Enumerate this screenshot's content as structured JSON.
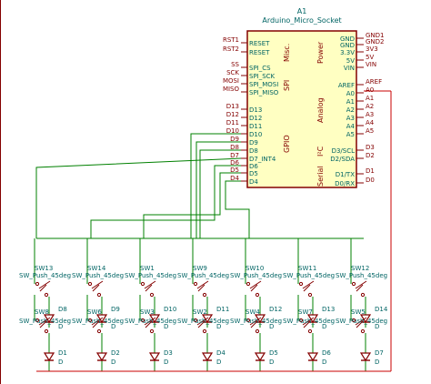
{
  "module": {
    "ref": "A1",
    "value": "Arduino_Micro_Socket",
    "sections": {
      "misc": "Misc.",
      "power": "Power",
      "spi": "SPI",
      "analog": "Analog",
      "i2c": "I²C",
      "serial": "Serial",
      "gpio": "GPIO"
    },
    "left_pins": [
      "RESET",
      "RESET",
      "SPI_CS",
      "SPI_SCK",
      "SPI_MOSI",
      "SPI_MISO",
      "D13",
      "D12",
      "D11",
      "D10",
      "D9",
      "D8",
      "D7_INT4",
      "D6",
      "D5",
      "D4"
    ],
    "right_pins": [
      "GND",
      "GND",
      "3.3V",
      "5V",
      "VIN",
      "AREF",
      "A0",
      "A1",
      "A2",
      "A3",
      "A4",
      "A5",
      "D3/SCL",
      "D2/SDA",
      "D1/TX",
      "D0/RX"
    ]
  },
  "net_labels": {
    "left": [
      "RST1",
      "RST2",
      "SS",
      "SCK",
      "MOSI",
      "MISO",
      "D13",
      "D12",
      "D11",
      "D10",
      "D9",
      "D8",
      "D7",
      "D6",
      "D5",
      "D4"
    ],
    "right": [
      "GND1",
      "GND2",
      "3V3",
      "5V",
      "VIN",
      "AREF",
      "A0",
      "A1",
      "A2",
      "A3",
      "A4",
      "A5",
      "D3",
      "D2",
      "D1",
      "D0"
    ]
  },
  "switches_top": [
    "SW13",
    "SW14",
    "SW1",
    "SW9",
    "SW10",
    "SW11",
    "SW12"
  ],
  "switches_bottom": [
    "SW8",
    "SW6",
    "SW3",
    "SW2",
    "SW4",
    "SW7",
    "SW5"
  ],
  "switch_value": "SW_Push_45deg",
  "diodes_top": [
    "D8",
    "D9",
    "D10",
    "D11",
    "D12",
    "D13",
    "D14"
  ],
  "diodes_bottom": [
    "D1",
    "D2",
    "D3",
    "D4",
    "D5",
    "D6",
    "D7"
  ],
  "diode_value": "D",
  "colors": {
    "body": "#840000",
    "fill": "#ffffc2",
    "wire": "#008000",
    "pin": "#840000",
    "text": "#006464",
    "net": "#840000",
    "diode": "#0000c8"
  }
}
